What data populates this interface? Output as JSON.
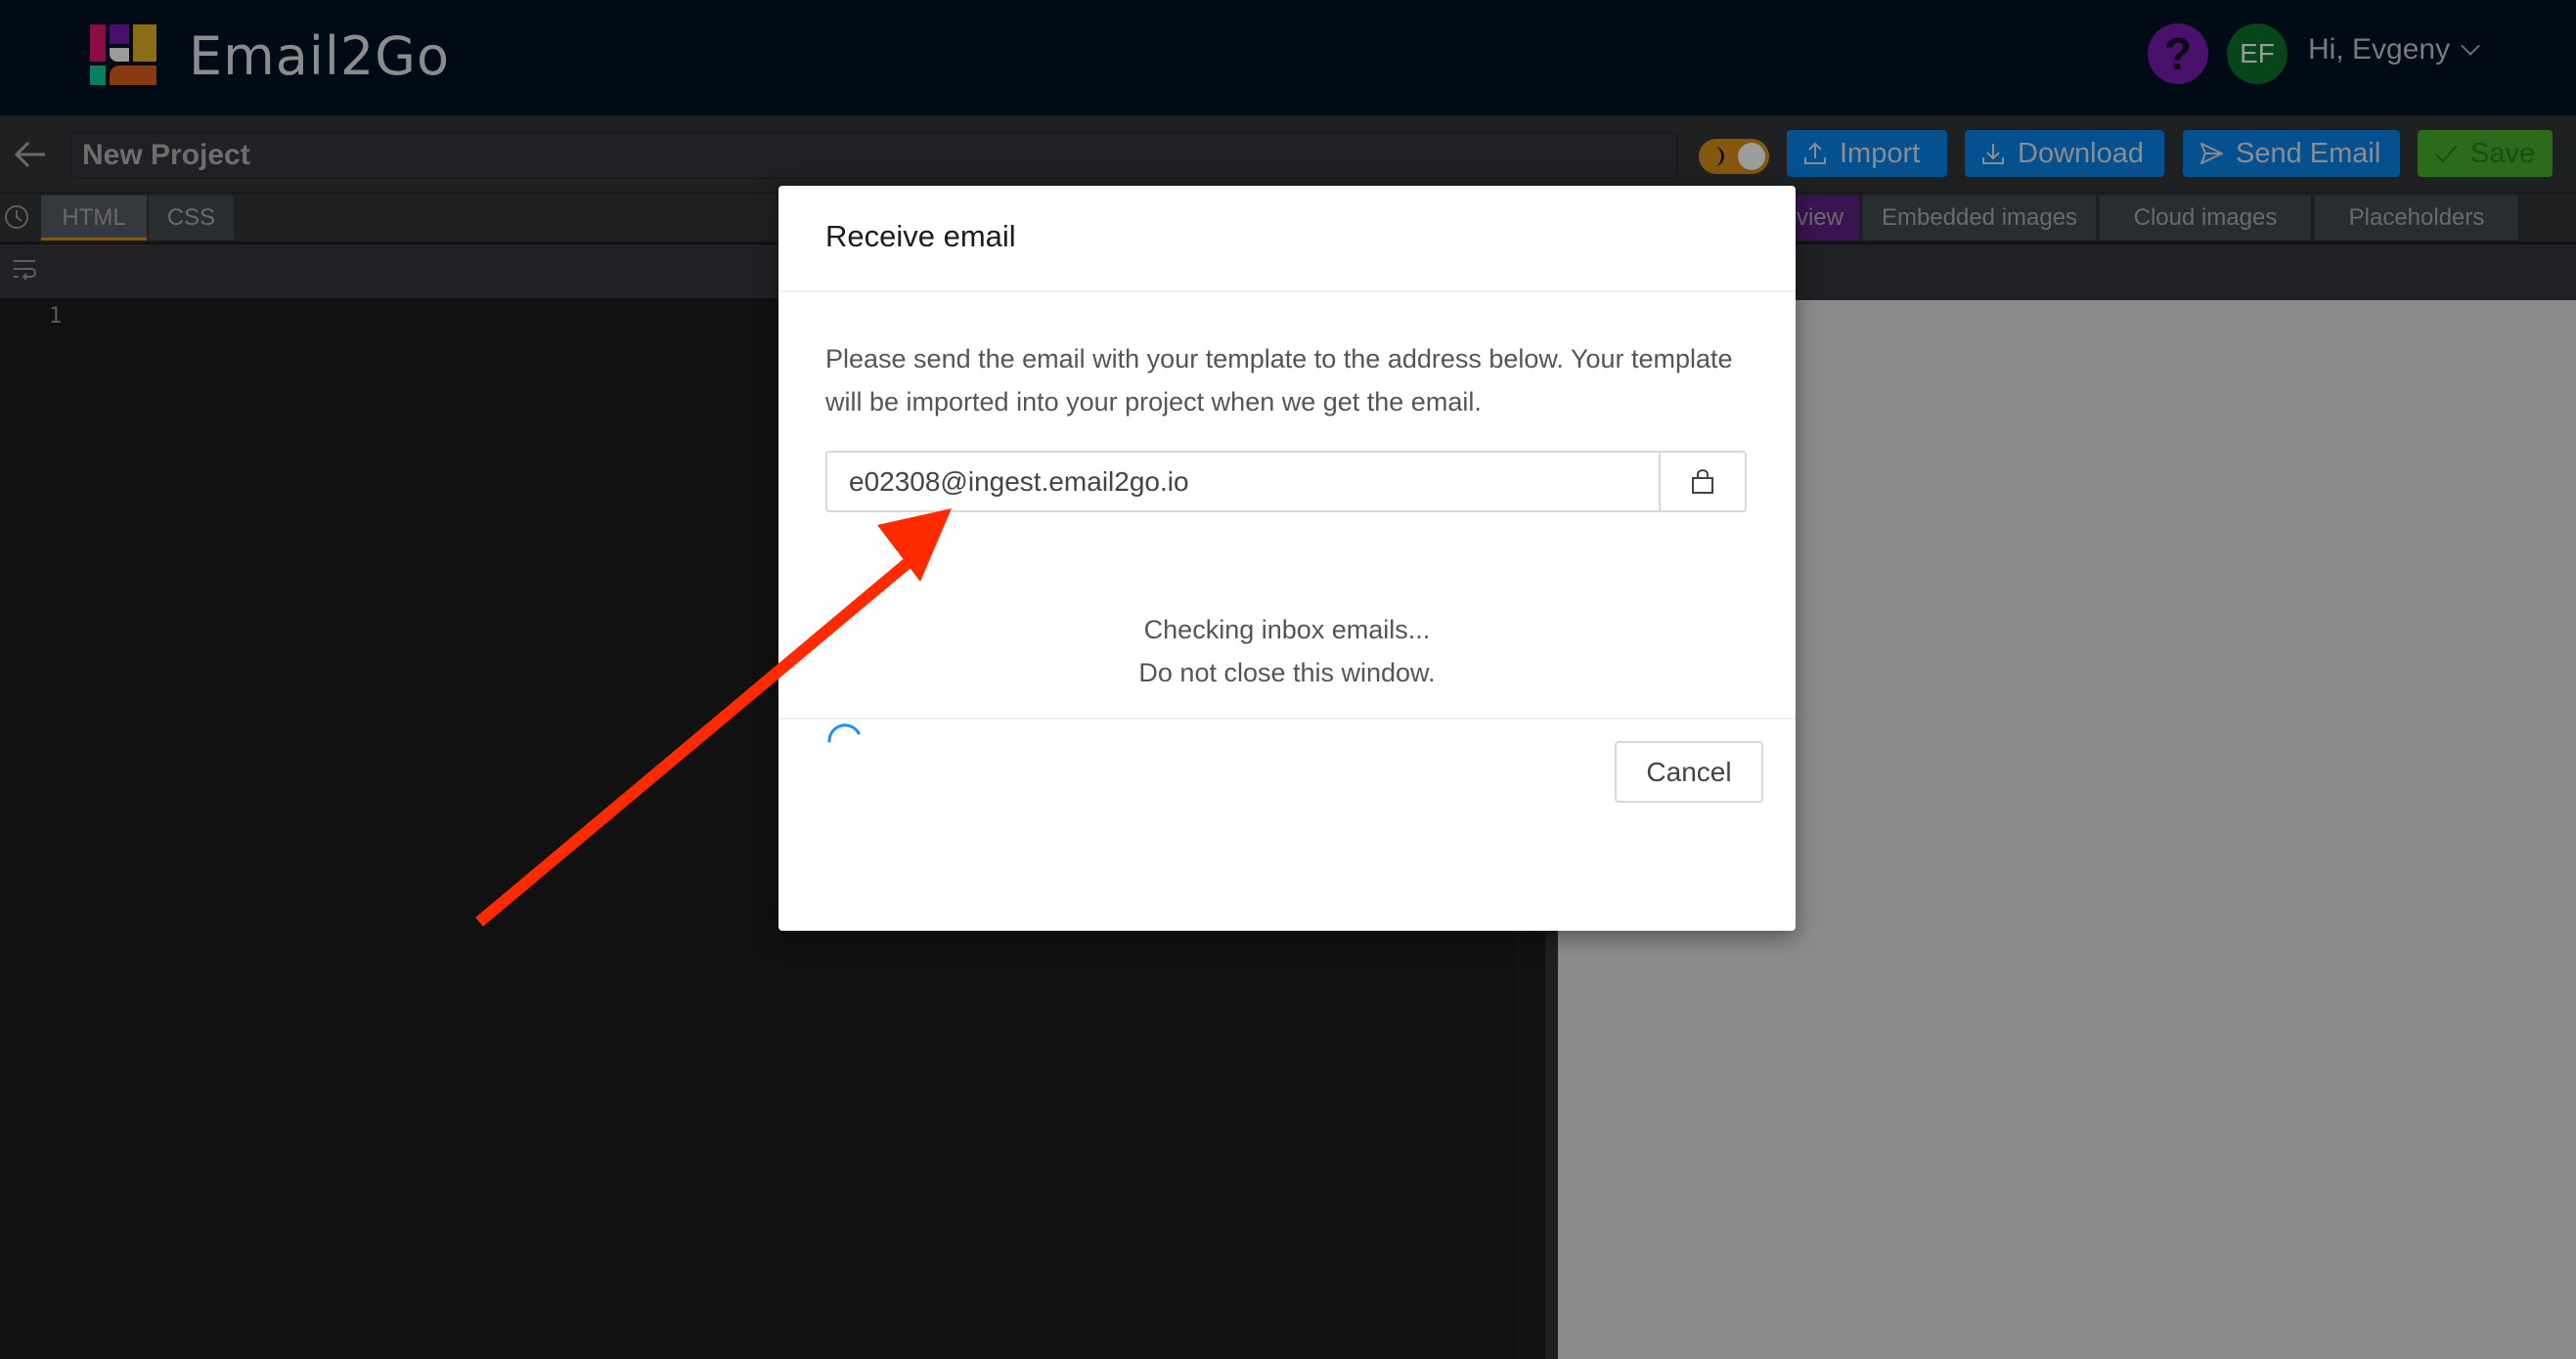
{
  "header": {
    "brand": "Email2Go",
    "help_label": "?",
    "avatar_initials": "EF",
    "greeting": "Hi, Evgeny",
    "logo_colors": [
      "#8a0d45",
      "#4a0f6e",
      "#8a6e15",
      "#9a9a9a",
      "#058060",
      "#8a3a13"
    ]
  },
  "toolbar": {
    "project_name": "New Project",
    "import_label": "Import",
    "download_label": "Download",
    "send_label": "Send Email",
    "save_label": "Save"
  },
  "editor": {
    "tabs": [
      {
        "label": "HTML",
        "active": true
      },
      {
        "label": "CSS",
        "active": false
      }
    ],
    "line_numbers": [
      "1"
    ]
  },
  "preview": {
    "tabs": [
      {
        "label": "Preview",
        "visible_label": "view",
        "active": true
      },
      {
        "label": "Embedded images",
        "active": false
      },
      {
        "label": "Cloud images",
        "active": false
      },
      {
        "label": "Placeholders",
        "active": false
      }
    ]
  },
  "modal": {
    "title": "Receive email",
    "description": "Please send the email with your template to the address below. Your template will be imported into your project when we get the email.",
    "address": "e02308@ingest.email2go.io",
    "status_line1": "Checking inbox emails...",
    "status_line2": "Do not close this window.",
    "cancel_label": "Cancel"
  },
  "annotation": {
    "arrow_color": "#ff2a00"
  }
}
